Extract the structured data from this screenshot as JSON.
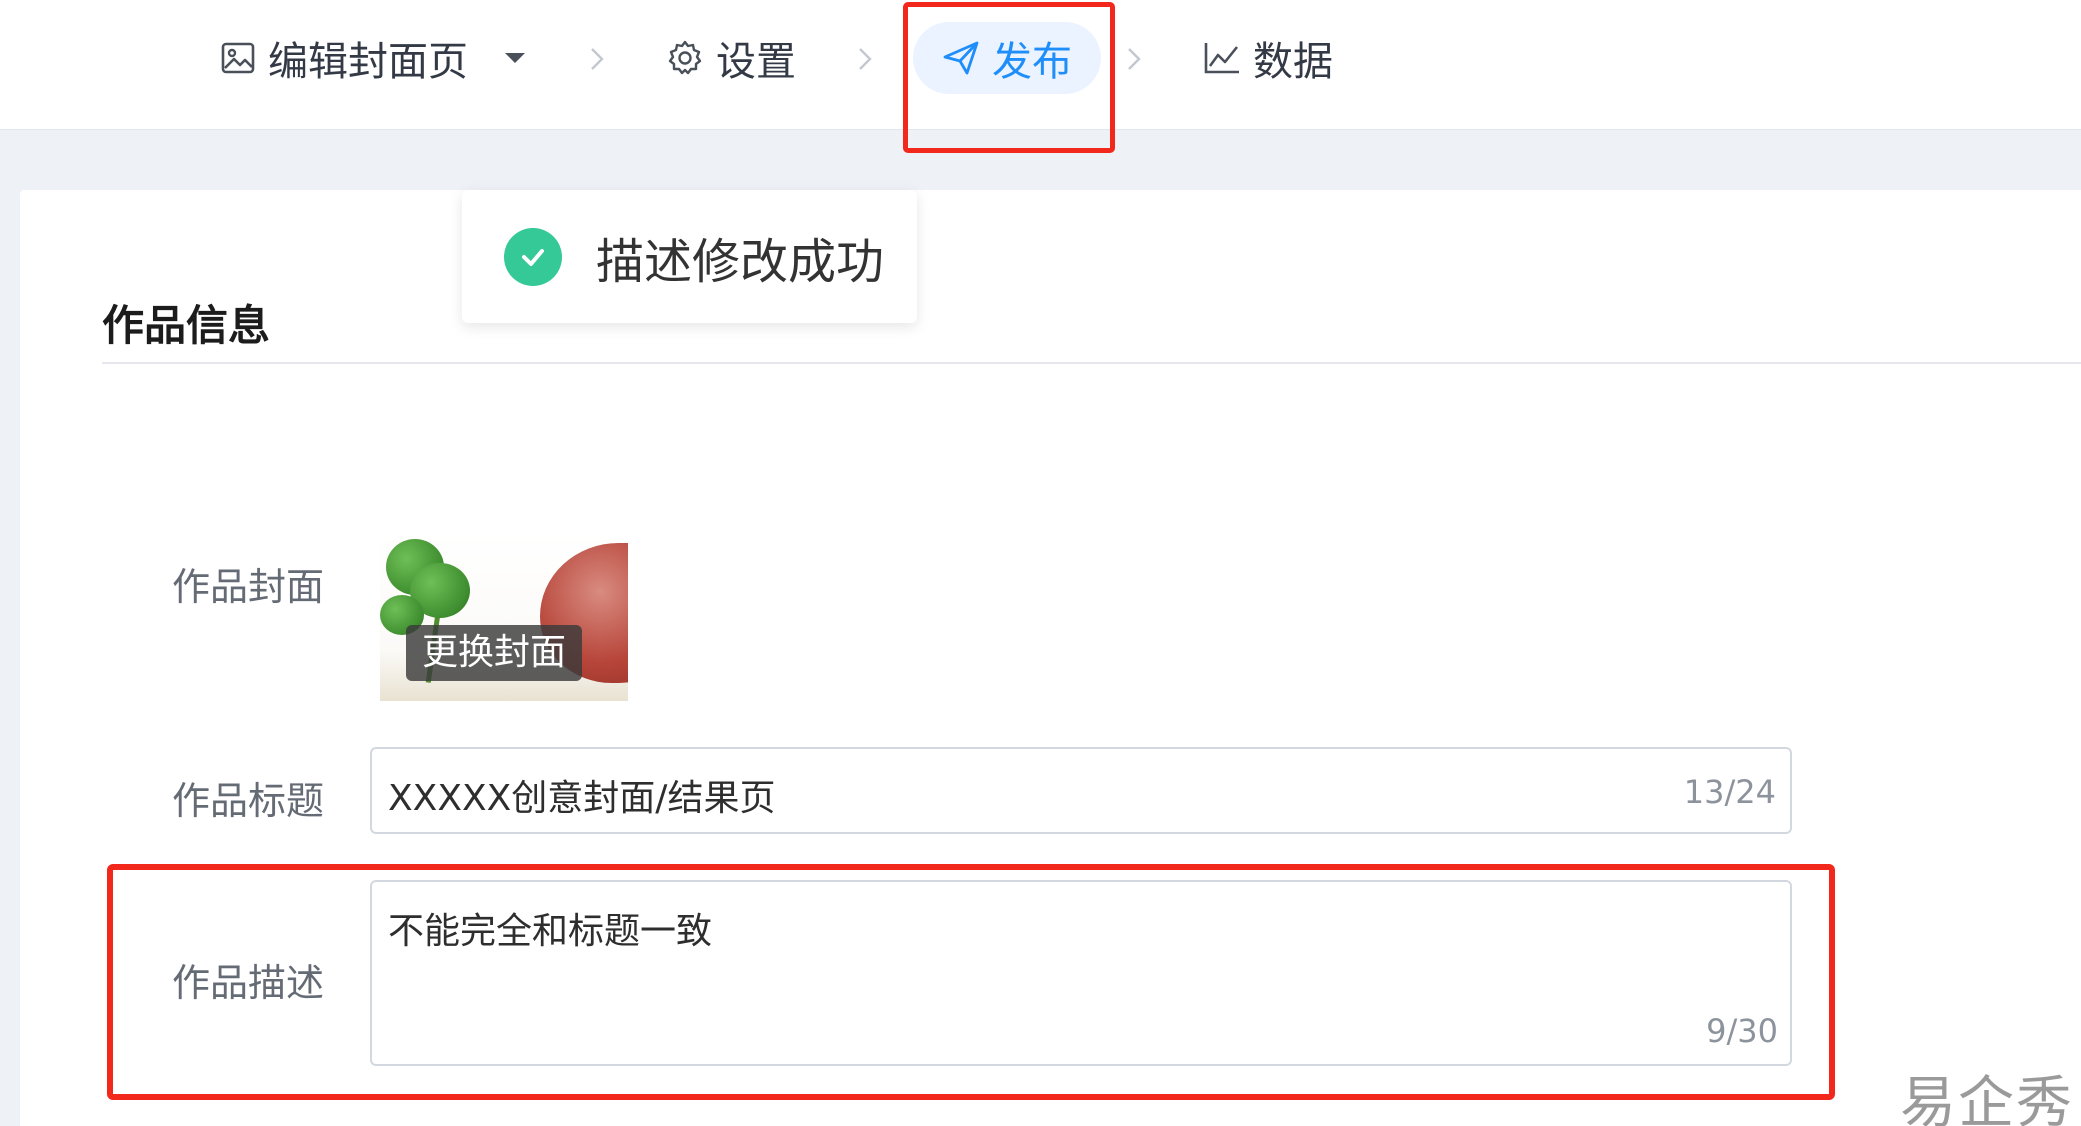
{
  "steps": {
    "edit": {
      "label": "编辑封面页",
      "icon": "image-icon"
    },
    "settings": {
      "label": "设置",
      "icon": "gear-icon"
    },
    "publish": {
      "label": "发布",
      "icon": "send-icon",
      "active": true
    },
    "data": {
      "label": "数据",
      "icon": "line-chart-icon"
    }
  },
  "toast": {
    "message": "描述修改成功",
    "icon": "success-check-icon"
  },
  "section": {
    "title": "作品信息"
  },
  "form": {
    "cover": {
      "label": "作品封面",
      "change_button": "更换封面"
    },
    "title": {
      "label": "作品标题",
      "value": "XXXXX创意封面/结果页",
      "counter": "13/24"
    },
    "description": {
      "label": "作品描述",
      "value": "不能完全和标题一致",
      "counter": "9/30"
    }
  },
  "watermark": "易企秀",
  "colors": {
    "accent": "#1f8efa",
    "highlight": "#f2281d",
    "success": "#34c996",
    "background_band": "#eef1f6"
  }
}
